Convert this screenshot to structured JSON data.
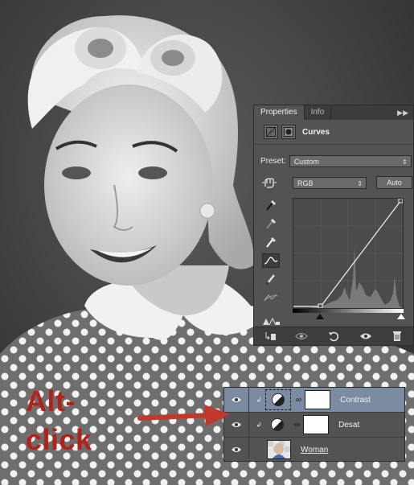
{
  "properties_panel": {
    "tabs": [
      "Properties",
      "Info"
    ],
    "menu_icon": "panel-menu-icon",
    "title": "Curves",
    "preset_label": "Preset:",
    "preset_value": "Custom",
    "channel_value": "RGB",
    "auto_label": "Auto",
    "tools": [
      "on-image-adjust-icon",
      "black-point-eyedropper-icon",
      "gray-point-eyedropper-icon",
      "white-point-eyedropper-icon",
      "curve-points-icon",
      "pencil-icon",
      "smooth-icon",
      "clipping-warning-icon"
    ],
    "bottom_icons": [
      "clip-to-layer-icon",
      "view-previous-icon",
      "reset-icon",
      "visibility-icon",
      "trash-icon"
    ]
  },
  "layers_panel": {
    "layers": [
      {
        "name": "Contrast",
        "kind": "adjustment",
        "clipped": true,
        "selected": true
      },
      {
        "name": "Desat",
        "kind": "adjustment",
        "clipped": true,
        "selected": false
      },
      {
        "name": "Woman",
        "kind": "pixel",
        "clipped": false,
        "selected": false
      }
    ]
  },
  "annotation": {
    "line1": "Alt-",
    "line2": "click",
    "color": "#b0241c"
  },
  "colors": {
    "panel_bg": "#535353",
    "selected_layer": "#7b8ba2",
    "annotation_red": "#b0241c"
  }
}
